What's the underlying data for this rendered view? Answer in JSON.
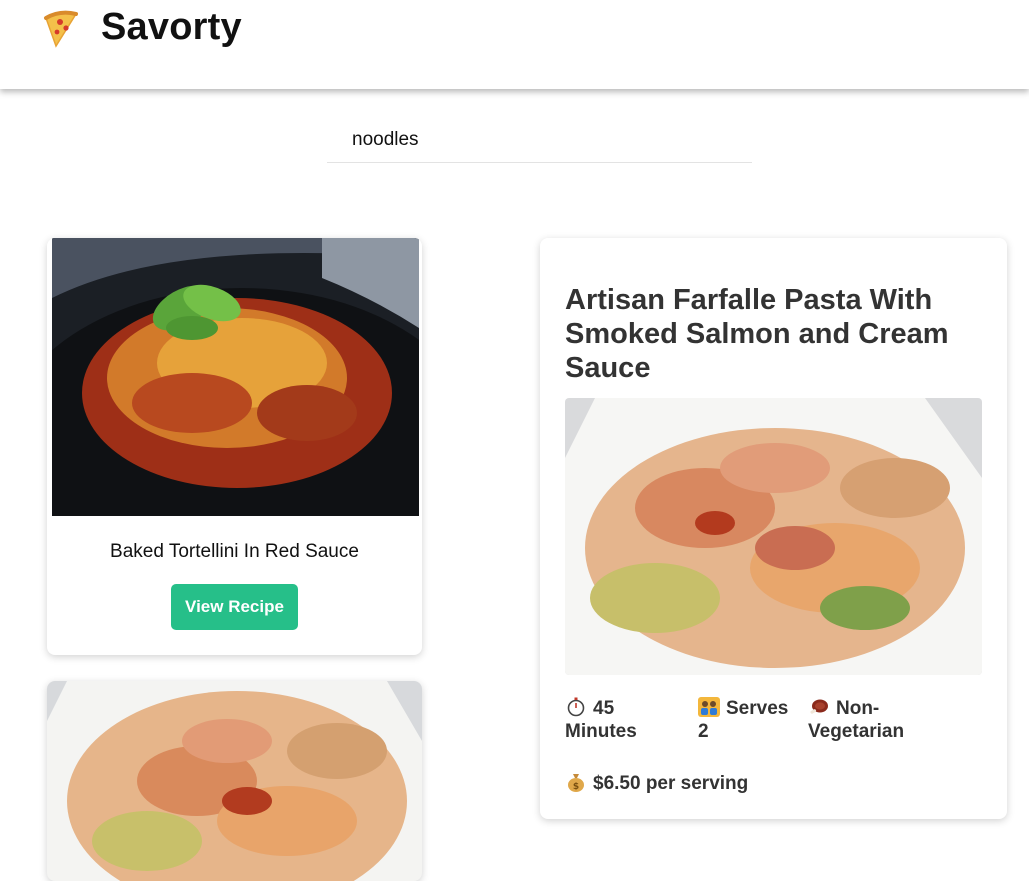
{
  "header": {
    "brand": "Savorty",
    "logo_icon": "pizza-slice-icon"
  },
  "search": {
    "value": "noodles"
  },
  "results": [
    {
      "title": "Baked Tortellini In Red Sauce",
      "button_label": "View Recipe",
      "image_icon": "baked-tortellini-photo"
    },
    {
      "title": "",
      "image_icon": "farfalle-pasta-photo"
    }
  ],
  "detail": {
    "title": "Artisan Farfalle Pasta With Smoked Salmon and Cream Sauce",
    "image_icon": "farfalle-pasta-photo",
    "time": {
      "icon": "stopwatch-icon",
      "text": "45 Minutes"
    },
    "serves": {
      "icon": "people-icon",
      "text": "Serves 2"
    },
    "diet": {
      "icon": "meat-icon",
      "text": "Non-Vegetarian"
    },
    "price": {
      "icon": "money-bag-icon",
      "text": "$6.50 per serving"
    }
  },
  "colors": {
    "accent": "#26bf89",
    "title": "#333333"
  }
}
